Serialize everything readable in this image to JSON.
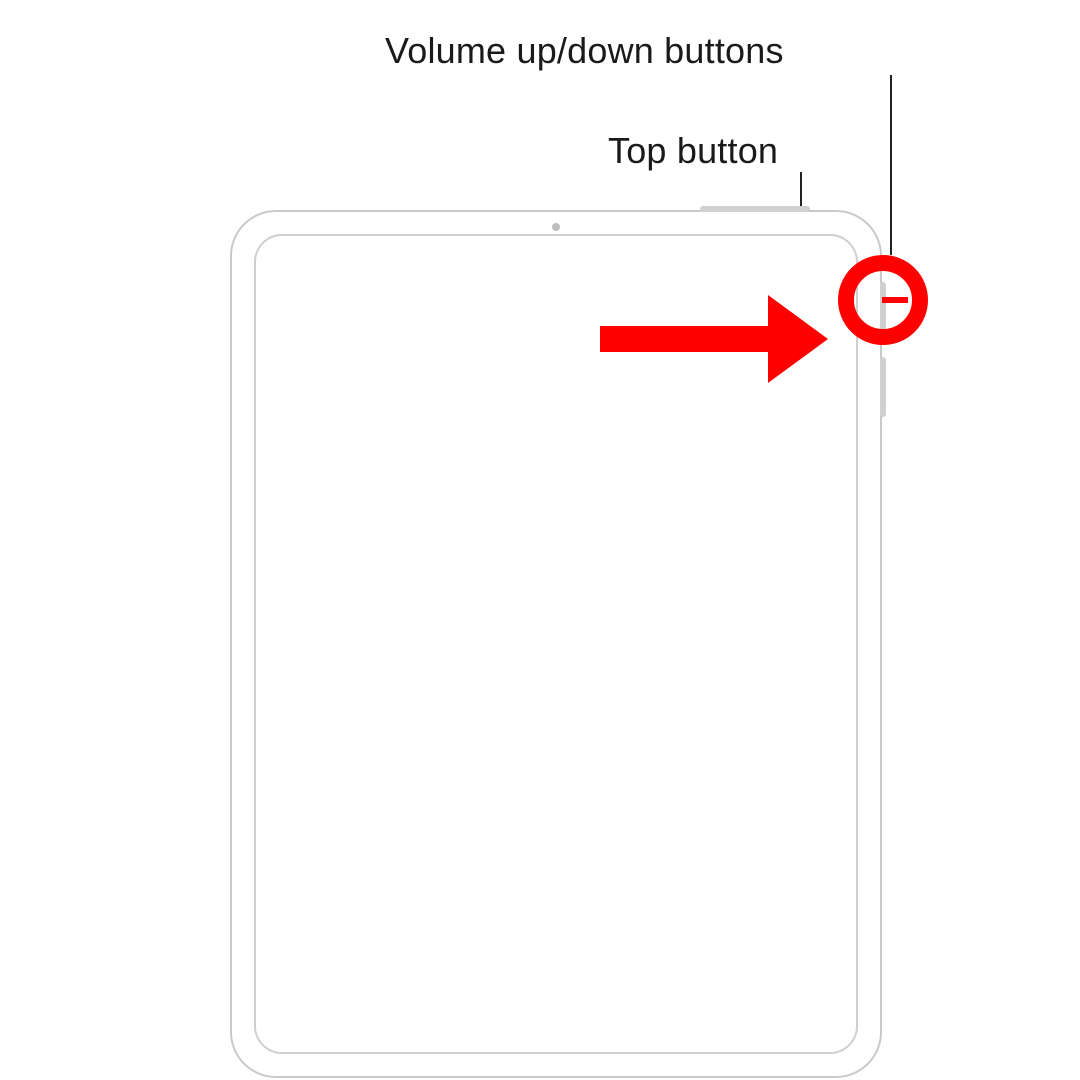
{
  "labels": {
    "volume": "Volume up/down buttons",
    "top_button": "Top button"
  }
}
